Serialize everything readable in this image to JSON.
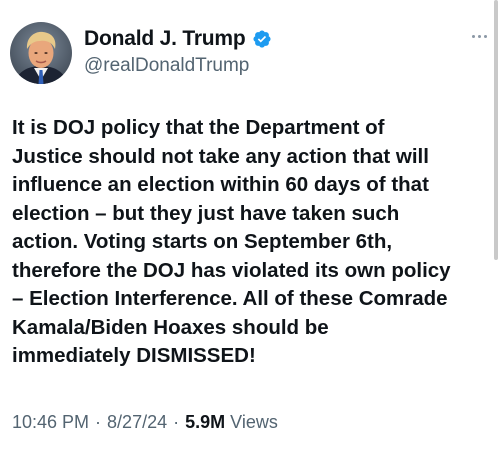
{
  "author": {
    "display_name": "Donald J. Trump",
    "handle": "@realDonaldTrump",
    "verified": true,
    "avatar_icon": "profile-photo"
  },
  "tweet": {
    "text": "It is DOJ policy that the Department of\nJustice should not take any action that will\ninfluence an election within 60 days of that\nelection – but they just have taken such\naction. Voting starts on September 6th,\ntherefore the DOJ has violated its own policy\n– Election Interference. All of these Comrade\nKamala/Biden Hoaxes should be\nimmediately DISMISSED!"
  },
  "meta": {
    "time": "10:46 PM",
    "separator": "·",
    "date": "8/27/24",
    "views_count": "5.9M",
    "views_label": "Views"
  },
  "colors": {
    "verified_blue": "#1d9bf0",
    "secondary_text": "#536471",
    "primary_text": "#0f1419"
  },
  "icons": {
    "verified": "verified-badge-icon",
    "more": "more-options-icon"
  }
}
